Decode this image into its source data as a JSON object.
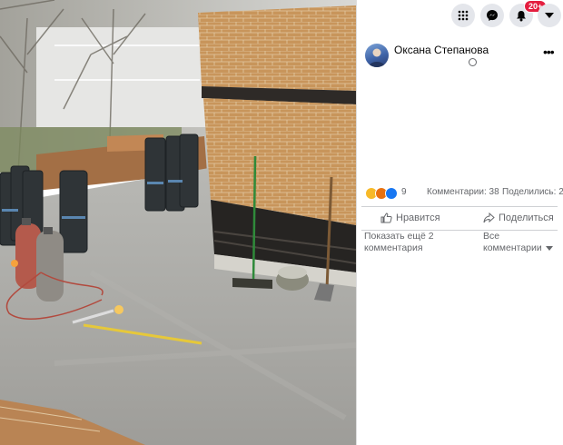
{
  "header": {
    "icons": [
      "grid-menu-icon",
      "messenger-icon",
      "bell-icon",
      "caret-down-icon"
    ],
    "notification_badge": "20+"
  },
  "post": {
    "author": "Оксана Степанова",
    "privacy_icon": "globe-icon",
    "options_icon": "more-options-icon"
  },
  "stats": {
    "reaction_icons": [
      "wow-reaction",
      "angry-reaction",
      "like-reaction"
    ],
    "reaction_count": "9",
    "comments": "Комментарии: 38",
    "shares": "Поделились: 2"
  },
  "actions": {
    "like": "Нравится",
    "share": "Поделиться"
  },
  "comments_bar": {
    "show_more": "Показать ещё 2 комментария",
    "filter": "Все комментарии"
  },
  "colors": {
    "badge": "#e41e3f",
    "secondary_text": "#65676b",
    "like_blue": "#1877f2",
    "reaction_yellow": "#f7b928",
    "reaction_red": "#e9710f"
  }
}
